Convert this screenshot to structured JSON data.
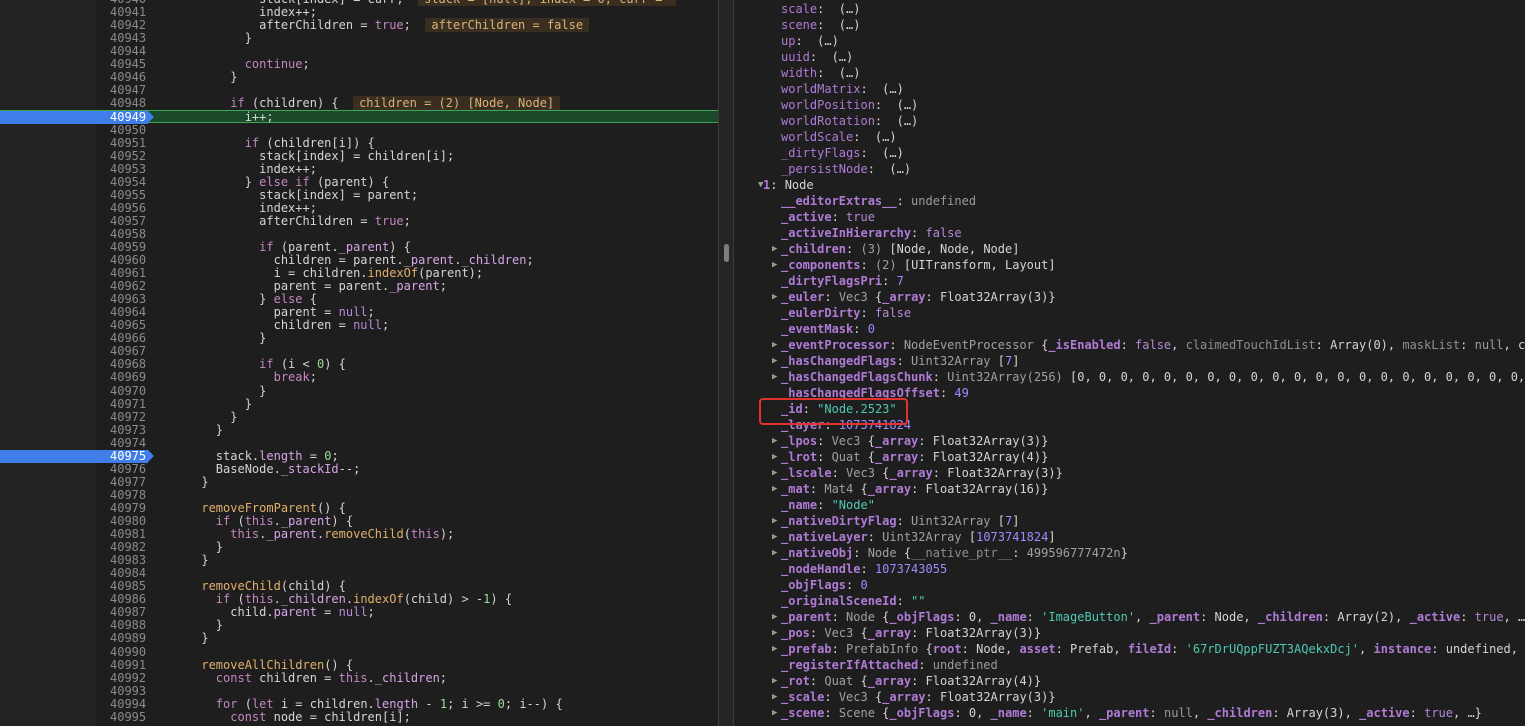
{
  "source": {
    "lines": [
      {
        "n": "40940",
        "html": "              stack[index] = curr;  <span class=\"cmt-inline\">stack = [null], index = 0, curr = </span>"
      },
      {
        "n": "40941",
        "html": "              index++;"
      },
      {
        "n": "40942",
        "html": "              afterChildren = <span class=\"kw\">true</span>;  <span class=\"cmt-inline\">afterChildren = false</span>"
      },
      {
        "n": "40943",
        "html": "            }"
      },
      {
        "n": "40944",
        "html": ""
      },
      {
        "n": "40945",
        "html": "            <span class=\"kw\">continue</span>;"
      },
      {
        "n": "40946",
        "html": "          }"
      },
      {
        "n": "40947",
        "html": ""
      },
      {
        "n": "40948",
        "html": "          <span class=\"kw\">if</span> (children) {  <span class=\"cmt-inline\">children = (2) [Node, Node]</span>"
      },
      {
        "n": "40949",
        "html": "            i++;",
        "bp": true,
        "cur": true
      },
      {
        "n": "40950",
        "html": ""
      },
      {
        "n": "40951",
        "html": "            <span class=\"kw\">if</span> (children[i]) {"
      },
      {
        "n": "40952",
        "html": "              stack[index] = children[i];"
      },
      {
        "n": "40953",
        "html": "              index++;"
      },
      {
        "n": "40954",
        "html": "            } <span class=\"kw\">else if</span> (parent) {"
      },
      {
        "n": "40955",
        "html": "              stack[index] = parent;"
      },
      {
        "n": "40956",
        "html": "              index++;"
      },
      {
        "n": "40957",
        "html": "              afterChildren = <span class=\"kw\">true</span>;"
      },
      {
        "n": "40958",
        "html": ""
      },
      {
        "n": "40959",
        "html": "              <span class=\"kw\">if</span> (parent.<span class=\"prop\">_parent</span>) {"
      },
      {
        "n": "40960",
        "html": "                children = parent.<span class=\"prop\">_parent</span>.<span class=\"prop\">_children</span>;"
      },
      {
        "n": "40961",
        "html": "                i = children.<span class=\"fn\">indexOf</span>(parent);"
      },
      {
        "n": "40962",
        "html": "                parent = parent.<span class=\"prop\">_parent</span>;"
      },
      {
        "n": "40963",
        "html": "              } <span class=\"kw\">else</span> {"
      },
      {
        "n": "40964",
        "html": "                parent = <span class=\"nl\">null</span>;"
      },
      {
        "n": "40965",
        "html": "                children = <span class=\"nl\">null</span>;"
      },
      {
        "n": "40966",
        "html": "              }"
      },
      {
        "n": "40967",
        "html": ""
      },
      {
        "n": "40968",
        "html": "              <span class=\"kw\">if</span> (i &lt; <span class=\"num\">0</span>) {"
      },
      {
        "n": "40969",
        "html": "                <span class=\"kw\">break</span>;"
      },
      {
        "n": "40970",
        "html": "              }"
      },
      {
        "n": "40971",
        "html": "            }"
      },
      {
        "n": "40972",
        "html": "          }"
      },
      {
        "n": "40973",
        "html": "        }"
      },
      {
        "n": "40974",
        "html": ""
      },
      {
        "n": "40975",
        "html": "        stack.<span class=\"prop\">length</span> = <span class=\"num\">0</span>;",
        "bp": true
      },
      {
        "n": "40976",
        "html": "        BaseNode.<span class=\"prop\">_stackId</span>--;"
      },
      {
        "n": "40977",
        "html": "      }"
      },
      {
        "n": "40978",
        "html": ""
      },
      {
        "n": "40979",
        "html": "      <span class=\"fn\">removeFromParent</span>() {"
      },
      {
        "n": "40980",
        "html": "        <span class=\"kw\">if</span> (<span class=\"kw\">this</span>.<span class=\"prop\">_parent</span>) {"
      },
      {
        "n": "40981",
        "html": "          <span class=\"kw\">this</span>.<span class=\"prop\">_parent</span>.<span class=\"fn\">removeChild</span>(<span class=\"kw\">this</span>);"
      },
      {
        "n": "40982",
        "html": "        }"
      },
      {
        "n": "40983",
        "html": "      }"
      },
      {
        "n": "40984",
        "html": ""
      },
      {
        "n": "40985",
        "html": "      <span class=\"fn\">removeChild</span>(child) {"
      },
      {
        "n": "40986",
        "html": "        <span class=\"kw\">if</span> (<span class=\"kw\">this</span>.<span class=\"prop\">_children</span>.<span class=\"fn\">indexOf</span>(child) &gt; -<span class=\"num\">1</span>) {"
      },
      {
        "n": "40987",
        "html": "          child.<span class=\"prop\">parent</span> = <span class=\"nl\">null</span>;"
      },
      {
        "n": "40988",
        "html": "        }"
      },
      {
        "n": "40989",
        "html": "      }"
      },
      {
        "n": "40990",
        "html": ""
      },
      {
        "n": "40991",
        "html": "      <span class=\"fn\">removeAllChildren</span>() {"
      },
      {
        "n": "40992",
        "html": "        <span class=\"kw\">const</span> children = <span class=\"kw\">this</span>.<span class=\"prop\">_children</span>;"
      },
      {
        "n": "40993",
        "html": ""
      },
      {
        "n": "40994",
        "html": "        <span class=\"kw\">for</span> (<span class=\"kw\">let</span> i = children.<span class=\"prop\">length</span> - <span class=\"num\">1</span>; i &gt;= <span class=\"num\">0</span>; i--) {"
      },
      {
        "n": "40995",
        "html": "          <span class=\"kw\">const</span> node = children[i];"
      }
    ]
  },
  "scope": {
    "rows": [
      {
        "html": "<span class=\"k\">scale</span>: <span class=\"v\"> (…)</span>"
      },
      {
        "html": "<span class=\"k\">scene</span>: <span class=\"v\"> (…)</span>"
      },
      {
        "html": "<span class=\"k\">up</span>: <span class=\"v\"> (…)</span>"
      },
      {
        "html": "<span class=\"k\">uuid</span>: <span class=\"v\"> (…)</span>"
      },
      {
        "html": "<span class=\"k\">width</span>: <span class=\"v\"> (…)</span>"
      },
      {
        "html": "<span class=\"k\">worldMatrix</span>: <span class=\"v\"> (…)</span>"
      },
      {
        "html": "<span class=\"k\">worldPosition</span>: <span class=\"v\"> (…)</span>"
      },
      {
        "html": "<span class=\"k\">worldRotation</span>: <span class=\"v\"> (…)</span>"
      },
      {
        "html": "<span class=\"k\">worldScale</span>: <span class=\"v\"> (…)</span>"
      },
      {
        "html": "<span class=\"k\">_dirtyFlags</span>: <span class=\"v\"> (…)</span>"
      },
      {
        "html": "<span class=\"k\">_persistNode</span>: <span class=\"v\"> (…)</span>"
      },
      {
        "html": "<span class=\"kb\">1</span>: <span class=\"v\">Node</span>",
        "tri": "open",
        "indent": 0
      },
      {
        "html": "<span class=\"kb\">__editorExtras__</span>: <span class=\"vu\">undefined</span>"
      },
      {
        "html": "<span class=\"kb\">_active</span>: <span class=\"vb\">true</span>"
      },
      {
        "html": "<span class=\"kb\">_activeInHierarchy</span>: <span class=\"vb\">false</span>"
      },
      {
        "html": "<span class=\"kb\">_children</span>: <span class=\"grey\">(3)</span> [Node, Node, Node]",
        "tri": "closed"
      },
      {
        "html": "<span class=\"kb\">_components</span>: <span class=\"grey\">(2)</span> [UITransform, Layout]",
        "tri": "closed"
      },
      {
        "html": "<span class=\"kb\">_dirtyFlagsPri</span>: <span class=\"vnum\">7</span>"
      },
      {
        "html": "<span class=\"kb\">_euler</span>: <span class=\"grey\">Vec3</span> {<span class=\"kb\">_array</span>: Float32Array(3)}",
        "tri": "closed"
      },
      {
        "html": "<span class=\"kb\">_eulerDirty</span>: <span class=\"vb\">false</span>"
      },
      {
        "html": "<span class=\"kb\">_eventMask</span>: <span class=\"vnum\">0</span>"
      },
      {
        "html": "<span class=\"kb\">_eventProcessor</span>: <span class=\"grey\">NodeEventProcessor</span> {<span class=\"kb\">_isEnabled</span>: <span class=\"vb\">false</span>, <span class=\"kd\">claimedTouchIdList</span>: Array(0), <span class=\"kd\">maskList</span>: <span class=\"vu\">null</span>, c",
        "tri": "closed"
      },
      {
        "html": "<span class=\"kb\">_hasChangedFlags</span>: <span class=\"grey\">Uint32Array</span> [<span class=\"vnum\">7</span>]",
        "tri": "closed"
      },
      {
        "html": "<span class=\"kb\">_hasChangedFlagsChunk</span>: <span class=\"grey\">Uint32Array(256)</span> [0, 0, 0, 0, 0, 0, 0, 0, 0, 0, 0, 0, 0, 0, 0, 0, 0, 0, 0, 0, 0,",
        "tri": "closed"
      },
      {
        "html": "<span class=\"kb\">_hasChangedFlagsOffset</span>: <span class=\"vnum\">49</span>"
      },
      {
        "html": "<span class=\"kb\">_id</span>: <span class=\"vs\">\"Node.2523\"</span>"
      },
      {
        "html": "<span class=\"kb\">_layer</span>: <span class=\"vnum\">1073741824</span>"
      },
      {
        "html": "<span class=\"kb\">_lpos</span>: <span class=\"grey\">Vec3</span> {<span class=\"kb\">_array</span>: Float32Array(3)}",
        "tri": "closed"
      },
      {
        "html": "<span class=\"kb\">_lrot</span>: <span class=\"grey\">Quat</span> {<span class=\"kb\">_array</span>: Float32Array(4)}",
        "tri": "closed"
      },
      {
        "html": "<span class=\"kb\">_lscale</span>: <span class=\"grey\">Vec3</span> {<span class=\"kb\">_array</span>: Float32Array(3)}",
        "tri": "closed"
      },
      {
        "html": "<span class=\"kb\">_mat</span>: <span class=\"grey\">Mat4</span> {<span class=\"kb\">_array</span>: Float32Array(16)}",
        "tri": "closed"
      },
      {
        "html": "<span class=\"kb\">_name</span>: <span class=\"vs\">\"Node\"</span>"
      },
      {
        "html": "<span class=\"kb\">_nativeDirtyFlag</span>: <span class=\"grey\">Uint32Array</span> [<span class=\"vnum\">7</span>]",
        "tri": "closed"
      },
      {
        "html": "<span class=\"kb\">_nativeLayer</span>: <span class=\"grey\">Uint32Array</span> [<span class=\"vnum\">1073741824</span>]",
        "tri": "closed"
      },
      {
        "html": "<span class=\"kb\">_nativeObj</span>: <span class=\"grey\">Node</span> {<span class=\"kd\">__native_ptr__</span>: <span class=\"grey\">499596777472n</span>}",
        "tri": "closed"
      },
      {
        "html": "<span class=\"kb\">_nodeHandle</span>: <span class=\"vnum\">1073743055</span>"
      },
      {
        "html": "<span class=\"kb\">_objFlags</span>: <span class=\"vnum\">0</span>"
      },
      {
        "html": "<span class=\"kb\">_originalSceneId</span>: <span class=\"vs\">\"\"</span>"
      },
      {
        "html": "<span class=\"kb\">_parent</span>: <span class=\"grey\">Node</span> {<span class=\"kb\">_objFlags</span>: 0, <span class=\"kb\">_name</span>: <span class=\"vs\">'ImageButton'</span>, <span class=\"kb\">_parent</span>: Node, <span class=\"kb\">_children</span>: Array(2), <span class=\"kb\">_active</span>: <span class=\"vb\">true</span>, …",
        "tri": "closed"
      },
      {
        "html": "<span class=\"kb\">_pos</span>: <span class=\"grey\">Vec3</span> {<span class=\"kb\">_array</span>: Float32Array(3)}",
        "tri": "closed"
      },
      {
        "html": "<span class=\"kb\">_prefab</span>: <span class=\"grey\">PrefabInfo</span> {<span class=\"kb\">root</span>: Node, <span class=\"kb\">asset</span>: Prefab, <span class=\"kb\">fileId</span>: <span class=\"vs\">'67rDrUQppFUZT3AQekxDcj'</span>, <span class=\"kb\">instance</span>: undefined,",
        "tri": "closed"
      },
      {
        "html": "<span class=\"kb\">_registerIfAttached</span>: <span class=\"vu\">undefined</span>"
      },
      {
        "html": "<span class=\"kb\">_rot</span>: <span class=\"grey\">Quat</span> {<span class=\"kb\">_array</span>: Float32Array(4)}",
        "tri": "closed"
      },
      {
        "html": "<span class=\"kb\">_scale</span>: <span class=\"grey\">Vec3</span> {<span class=\"kb\">_array</span>: Float32Array(3)}",
        "tri": "closed"
      },
      {
        "html": "<span class=\"kb\">_scene</span>: <span class=\"grey\">Scene</span> {<span class=\"kb\">_objFlags</span>: 0, <span class=\"kb\">_name</span>: <span class=\"vs\">'main'</span>, <span class=\"kb\">_parent</span>: <span class=\"vu\">null</span>, <span class=\"kb\">_children</span>: Array(3), <span class=\"kb\">_active</span>: <span class=\"vb\">true</span>, …}",
        "tri": "closed"
      }
    ]
  },
  "colors": {
    "accent_breakpoint": "#3f7ee8",
    "current_line": "#1b4a2a",
    "highlight_box": "#e0332e"
  },
  "icons": {
    "expand": "triangle-right-icon",
    "collapse": "triangle-down-icon"
  }
}
